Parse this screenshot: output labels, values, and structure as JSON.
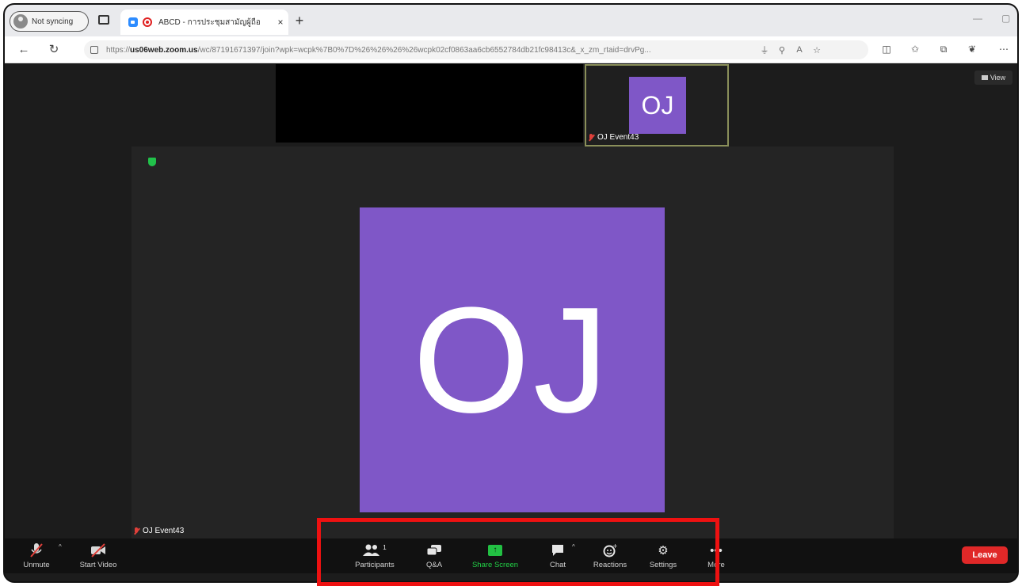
{
  "browser": {
    "sync_label": "Not syncing",
    "tab_title": "ABCD - การประชุมสามัญผู้ถือ",
    "tab_close": "×",
    "new_tab": "+",
    "url_prefix": "https://",
    "url_host": "us06web.zoom.us",
    "url_path": "/wc/87191671397/join?wpk=wcpk%7B0%7D%26%26%26%26wcpk02cf0863aa6cb6552784db21fc98413c&_x_zm_rtaid=drvPg..."
  },
  "meeting": {
    "view_label": "View",
    "thumbnail": {
      "initials": "OJ",
      "name": "OJ Event43"
    },
    "main": {
      "initials": "OJ",
      "name": "OJ Event43"
    }
  },
  "toolbar": {
    "unmute": "Unmute",
    "start_video": "Start Video",
    "participants": "Participants",
    "participant_count": "1",
    "qa": "Q&A",
    "share_screen": "Share Screen",
    "chat": "Chat",
    "reactions": "Reactions",
    "settings": "Settings",
    "more": "More",
    "leave": "Leave"
  },
  "colors": {
    "avatar": "#7f57c7",
    "share_green": "#22c043",
    "leave_red": "#e02828",
    "highlight_red": "#ee1111"
  },
  "icons": [
    "person-icon",
    "tab-actions-icon",
    "zoom-icon",
    "record-icon",
    "back-icon",
    "refresh-icon",
    "lock-icon",
    "mic-icon",
    "key-icon",
    "read-aloud-icon",
    "star-icon",
    "split-screen-icon",
    "favorites-icon",
    "collections-icon",
    "copilot-icon",
    "ellipsis-icon",
    "view-grid-icon",
    "shield-icon",
    "mic-off-icon",
    "video-off-icon",
    "participants-icon",
    "qa-icon",
    "share-screen-icon",
    "chat-icon",
    "reactions-icon",
    "gear-icon",
    "more-icon"
  ]
}
